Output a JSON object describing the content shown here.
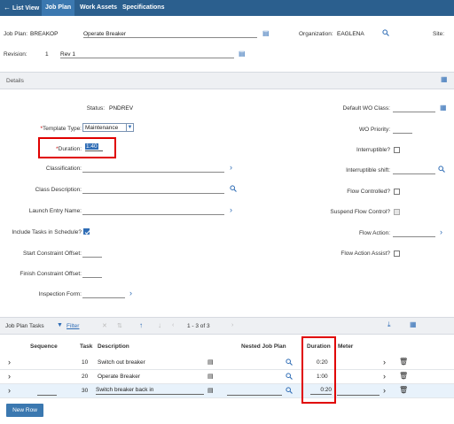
{
  "tabs": {
    "list_view": "List View",
    "job_plan": "Job Plan",
    "work_assets": "Work Assets",
    "specifications": "Specifications"
  },
  "header": {
    "job_plan_label": "Job Plan:",
    "job_plan_value": "BREAKOP",
    "job_plan_desc": "Operate Breaker",
    "organization_label": "Organization:",
    "organization_value": "EAGLENA",
    "site_label": "Site:",
    "revision_label": "Revision:",
    "revision_value": "1",
    "revision_desc": "Rev 1"
  },
  "details": {
    "section_label": "Details",
    "status_label": "Status:",
    "status_value": "PNDREV",
    "template_type_label": "Template Type:",
    "template_type_value": "Maintenance",
    "duration_label": "Duration:",
    "duration_value": "1:40",
    "classification_label": "Classification:",
    "class_description_label": "Class Description:",
    "launch_entry_label": "Launch Entry Name:",
    "include_tasks_label": "Include Tasks in Schedule?",
    "start_constraint_label": "Start Constraint Offset:",
    "finish_constraint_label": "Finish Constraint Offset:",
    "inspection_form_label": "Inspection Form:",
    "default_wo_class_label": "Default WO Class:",
    "wo_priority_label": "WO Priority:",
    "interruptible_label": "Interruptible?",
    "interruptible_shift_label": "Interruptible shift:",
    "flow_controlled_label": "Flow Controlled?",
    "suspend_flow_label": "Suspend Flow Control?",
    "flow_action_label": "Flow Action:",
    "flow_action_assist_label": "Flow Action Assist?"
  },
  "tasks": {
    "title": "Job Plan Tasks",
    "filter_label": "Filter",
    "pagination": "1 - 3 of 3",
    "columns": {
      "sequence": "Sequence",
      "task": "Task",
      "description": "Description",
      "nested_job_plan": "Nested Job Plan",
      "duration": "Duration",
      "meter": "Meter"
    },
    "rows": [
      {
        "task": "10",
        "description": "Switch out breaker",
        "duration": "0:20"
      },
      {
        "task": "20",
        "description": "Operate Breaker",
        "duration": "1:00"
      },
      {
        "task": "30",
        "description": "Switch breaker back in",
        "duration": "0:20"
      }
    ],
    "new_row_label": "New Row"
  },
  "colors": {
    "topbar": "#2b5f8e",
    "active_tab": "#3b78b0",
    "accent": "#2e6cb5",
    "highlight": "#e00000"
  }
}
